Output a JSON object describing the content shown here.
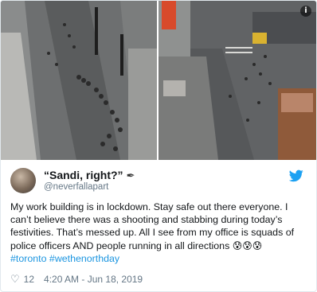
{
  "media": {
    "info_icon": "info-icon"
  },
  "author": {
    "display_name": "“Sandi, right?”",
    "pen_emoji": "✒",
    "handle": "@neverfallapart"
  },
  "tweet": {
    "text": "My work building is in lockdown. Stay safe out there everyone. I can’t believe there was a shooting and stabbing during today’s festivities. That’s messed up. All I see from my office is squads of police officers AND people running in all directions",
    "emojis": "😰😰😰",
    "hashtags": [
      "#toronto",
      "#wethenorthday"
    ]
  },
  "footer": {
    "likes": "12",
    "timestamp": "4:20 AM - Jun 18, 2019"
  },
  "colors": {
    "link": "#1b95e0",
    "twitter_brand": "#1da1f2",
    "muted": "#657786"
  }
}
